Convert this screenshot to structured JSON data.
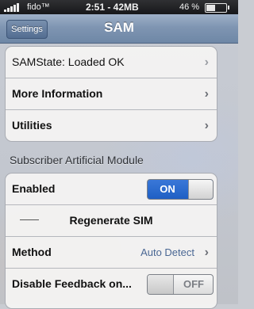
{
  "status_bar": {
    "carrier": "fido™",
    "time": "2:51 - 42MB",
    "battery": "46 %",
    "battery_level": 0.46
  },
  "navbar": {
    "back_label": "Settings",
    "title": "SAM"
  },
  "group_top": {
    "items": [
      {
        "label": "SAMState: Loaded OK",
        "chevron": "chevron-right-icon"
      },
      {
        "label": "More Information",
        "chevron": "chevron-right-icon"
      },
      {
        "label": "Utilities",
        "chevron": "chevron-right-icon"
      }
    ]
  },
  "section": {
    "header": "Subscriber Artificial Module",
    "enabled_label": "Enabled",
    "enabled_state": "ON",
    "regenerate_label": "Regenerate SIM",
    "method_label": "Method",
    "method_value": "Auto Detect",
    "feedback_label": "Disable Feedback on...",
    "feedback_state": "OFF"
  },
  "colors": {
    "toggle_on": "#2a6bd0",
    "navbar": "#7f95b2"
  }
}
